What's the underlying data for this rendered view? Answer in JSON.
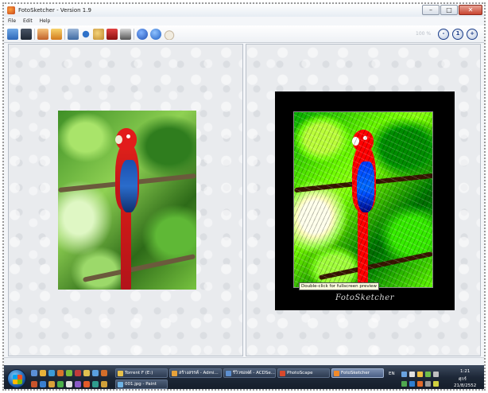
{
  "window": {
    "title": "FotoSketcher - Version 1.9",
    "minimize": "–",
    "maximize": "□",
    "close": "✕"
  },
  "menu": [
    "File",
    "Edit",
    "Help"
  ],
  "toolbar": {
    "icons": [
      "open-folder-icon",
      "save-icon",
      "load-settings-icon",
      "save-settings-icon",
      "choose-effect-icon",
      "undo-icon",
      "palette-icon",
      "text-icon",
      "frame-icon",
      "info-icon",
      "help-icon",
      "coffee-icon"
    ],
    "zoom": {
      "label": "100 %",
      "zoom_out": "-",
      "zoom_fit": "1",
      "zoom_in": "+"
    }
  },
  "panes": {
    "original": {
      "image": "scarlet macaw parrot photo"
    },
    "result": {
      "image": "sketched macaw painting",
      "tooltip": "Double-click for fullscreen preview",
      "signature": "FotoSketcher"
    }
  },
  "taskbar": {
    "tasks_row1": [
      {
        "label": "Torrent F (E:)",
        "color": "#e9c14a"
      },
      {
        "label": "สร้างสรรค์ - Admi...",
        "color": "#e7a23a"
      },
      {
        "label": "รีวิวซอฟต์ - ACDSe...",
        "color": "#5d8fd0"
      },
      {
        "label": "PhotoScape",
        "color": "#d8492c"
      },
      {
        "label": "FotoSketcher",
        "color": "#f08a2a"
      }
    ],
    "tasks_row2": [
      {
        "label": "001.jpg - Paint",
        "color": "#6fb3e5"
      }
    ],
    "tray": {
      "language": "EN",
      "time": "1:21",
      "day": "ศุกร์",
      "date": "21/8/2552"
    }
  }
}
